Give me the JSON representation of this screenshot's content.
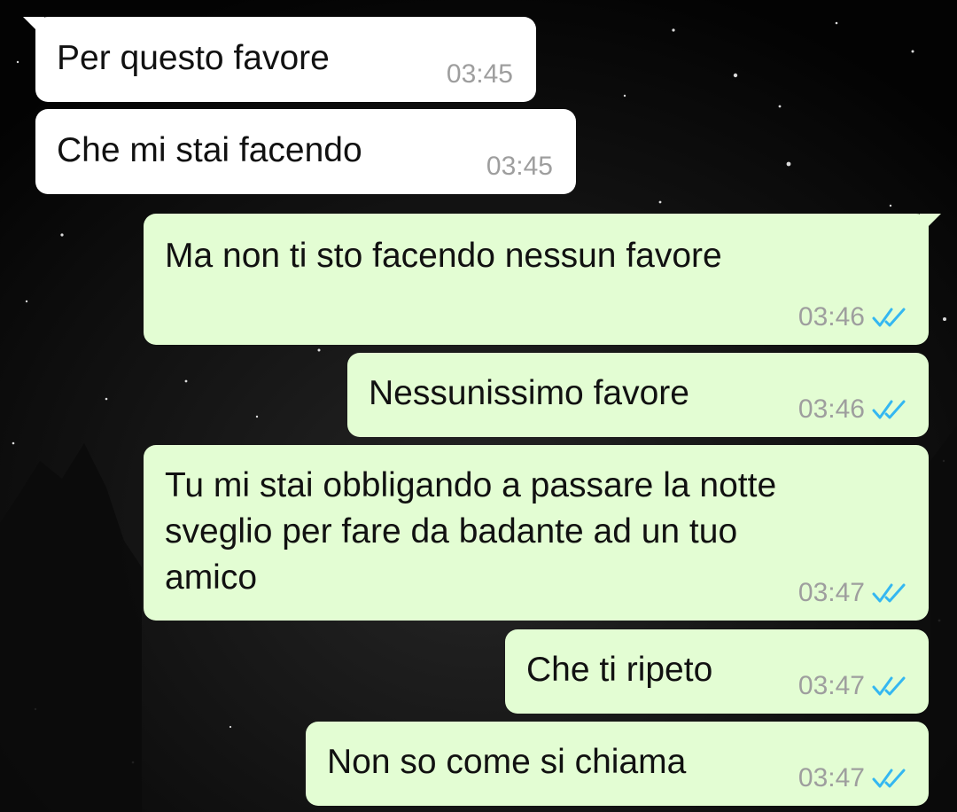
{
  "colors": {
    "incoming_bubble": "#ffffff",
    "outgoing_bubble": "#e3fdd3",
    "timestamp": "#9e9e9e",
    "read_ticks": "#34b7f1",
    "background": "#030303"
  },
  "messages": [
    {
      "direction": "incoming",
      "text": "Per questo favore",
      "time": "03:45",
      "status": null
    },
    {
      "direction": "incoming",
      "text": "Che mi stai facendo",
      "time": "03:45",
      "status": null
    },
    {
      "direction": "outgoing",
      "text": "Ma non ti sto facendo nessun favore",
      "time": "03:46",
      "status": "read",
      "status_icon": "double-check-icon"
    },
    {
      "direction": "outgoing",
      "text": "Nessunissimo favore",
      "time": "03:46",
      "status": "read",
      "status_icon": "double-check-icon"
    },
    {
      "direction": "outgoing",
      "text": "Tu mi stai obbligando a passare la notte\nsveglio per fare da badante ad un tuo\namico",
      "time": "03:47",
      "status": "read",
      "status_icon": "double-check-icon"
    },
    {
      "direction": "outgoing",
      "text": "Che ti ripeto",
      "time": "03:47",
      "status": "read",
      "status_icon": "double-check-icon"
    },
    {
      "direction": "outgoing",
      "text": "Non so come si chiama",
      "time": "03:47",
      "status": "read",
      "status_icon": "double-check-icon"
    }
  ]
}
